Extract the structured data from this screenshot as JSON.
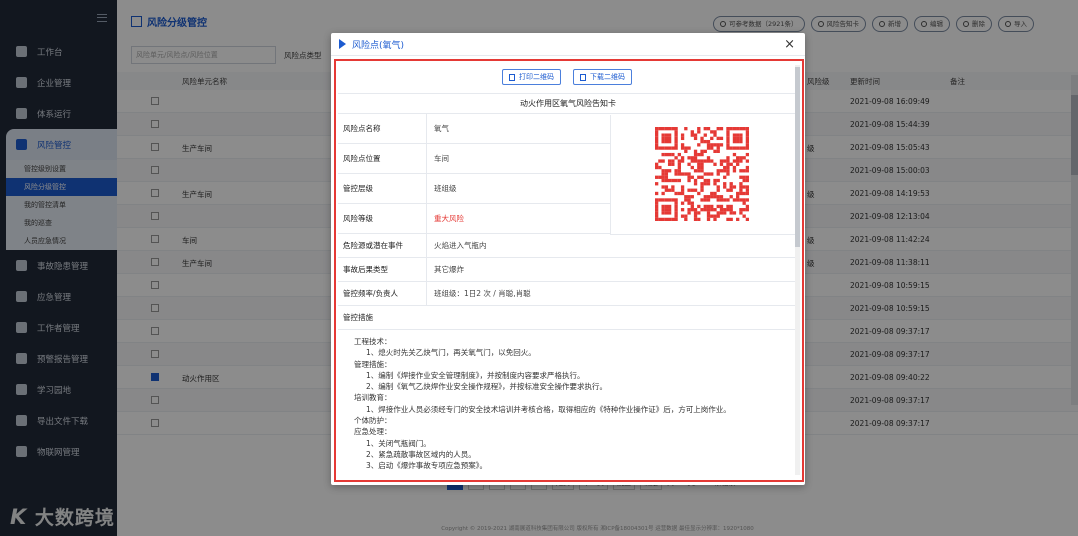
{
  "sidebar": {
    "items": [
      {
        "label": "工作台",
        "icon": "dashboard-icon"
      },
      {
        "label": "企业管理",
        "icon": "home-icon"
      },
      {
        "label": "体系运行",
        "icon": "layers-icon"
      },
      {
        "label": "风险管控",
        "icon": "risk-icon",
        "active": true
      },
      {
        "label": "事故隐患管理",
        "icon": "gear-icon"
      },
      {
        "label": "应急管理",
        "icon": "chart-icon"
      },
      {
        "label": "工作者管理",
        "icon": "calendar-icon"
      },
      {
        "label": "预警报告管理",
        "icon": "report-icon"
      },
      {
        "label": "学习园地",
        "icon": "graduation-icon"
      },
      {
        "label": "导出文件下载",
        "icon": "download-icon"
      },
      {
        "label": "物联网管理",
        "icon": "database-icon"
      }
    ],
    "sub_items": [
      "管控级别设置",
      "风险分级管控",
      "我的管控清单",
      "我的巡查",
      "人员应急情况"
    ],
    "sub_current": 1
  },
  "watermark": {
    "logo": "K",
    "text": "大数跨境"
  },
  "page": {
    "title": "风险分级管控",
    "toolbar": [
      "可参考数据（2921条）",
      "风险告知卡",
      "新增",
      "编辑",
      "删除",
      "导入"
    ],
    "filter_placeholder": "风险单元/风险点/风险位置",
    "filter_label": "风险点类型",
    "columns": [
      "风险单元名称",
      "风险级",
      "更新时间",
      "备注"
    ],
    "rows": [
      {
        "unit": "",
        "level": "",
        "time": "2021-09-08 16:09:49",
        "checked": false
      },
      {
        "unit": "",
        "level": "",
        "time": "2021-09-08 15:44:39",
        "checked": false
      },
      {
        "unit": "生产车间",
        "level": "级",
        "time": "2021-09-08 15:05:43",
        "checked": false
      },
      {
        "unit": "",
        "level": "",
        "time": "2021-09-08 15:00:03",
        "checked": false
      },
      {
        "unit": "生产车间",
        "level": "级",
        "time": "2021-09-08 14:19:53",
        "checked": false
      },
      {
        "unit": "",
        "level": "",
        "time": "2021-09-08 12:13:04",
        "checked": false
      },
      {
        "unit": "车间",
        "level": "级",
        "time": "2021-09-08 11:42:24",
        "checked": false
      },
      {
        "unit": "生产车间",
        "level": "级",
        "time": "2021-09-08 11:38:11",
        "checked": false
      },
      {
        "unit": "",
        "level": "",
        "time": "2021-09-08 10:59:15",
        "checked": false
      },
      {
        "unit": "",
        "level": "",
        "time": "2021-09-08 10:59:15",
        "checked": false
      },
      {
        "unit": "",
        "level": "",
        "time": "2021-09-08 09:37:17",
        "checked": false
      },
      {
        "unit": "",
        "level": "",
        "time": "2021-09-08 09:37:17",
        "checked": false
      },
      {
        "unit": "动火作用区",
        "level": "",
        "time": "2021-09-08 09:40:22",
        "checked": true
      },
      {
        "unit": "",
        "level": "",
        "time": "2021-09-08 09:37:17",
        "checked": false
      },
      {
        "unit": "",
        "level": "",
        "time": "2021-09-08 09:37:17",
        "checked": false
      }
    ],
    "pager": [
      "1",
      "2",
      "3",
      "4",
      "...",
      "尾页",
      "下一页",
      "跳至",
      "确定",
      "共150页/2222条记录"
    ],
    "footer": "Copyright © 2019-2021 湖南展道科技集团有限公司 版权所有 湘ICP备18004301号 运营数据  最佳显示分辨率：1920*1080"
  },
  "modal": {
    "title": "风险点(氧气)",
    "close": "×",
    "print_qr": "打印二维码",
    "download_qr": "下载二维码",
    "card_title": "动火作用区氧气风险告知卡",
    "fields": [
      {
        "label": "风险点名称",
        "value": "氧气"
      },
      {
        "label": "风险点位置",
        "value": "车间"
      },
      {
        "label": "管控层级",
        "value": "班组级"
      },
      {
        "label": "风险等级",
        "value": "重大风险",
        "color": "#e53935"
      }
    ],
    "hazard_label": "危险源或潜在事件",
    "hazard_value": "火焰进入气瓶内",
    "consequence_label": "事故后果类型",
    "consequence_value": "其它爆炸",
    "freq_label": "管控频率/负责人",
    "freq_value": "班组级：1日2 次 / 肖聪,肖聪",
    "measures_label": "管控措施",
    "measures": [
      {
        "text": "工程技术：",
        "indent": 0
      },
      {
        "text": "1、熄火时先关乙炔气门，再关氧气门，以免回火。",
        "indent": 1
      },
      {
        "text": "管理措施：",
        "indent": 0
      },
      {
        "text": "1、编制《焊接作业安全管理制度》，并按制度内容要求严格执行。",
        "indent": 1
      },
      {
        "text": "2、编制《氧气乙炔焊作业安全操作规程》，并按标准安全操作要求执行。",
        "indent": 1
      },
      {
        "text": "培训教育：",
        "indent": 0
      },
      {
        "text": "1、焊接作业人员必须经专门的安全技术培训并考核合格，取得相应的《特种作业操作证》后，方可上岗作业。",
        "indent": 1
      },
      {
        "text": "个体防护：",
        "indent": 0
      },
      {
        "text": "应急处理：",
        "indent": 0
      },
      {
        "text": "1、关闭气瓶阀门。",
        "indent": 1
      },
      {
        "text": "2、紧急疏散事故区域内的人员。",
        "indent": 1
      },
      {
        "text": "3、启动《爆炸事故专项应急预案》。",
        "indent": 1
      }
    ],
    "qr_color": "#e53935"
  }
}
